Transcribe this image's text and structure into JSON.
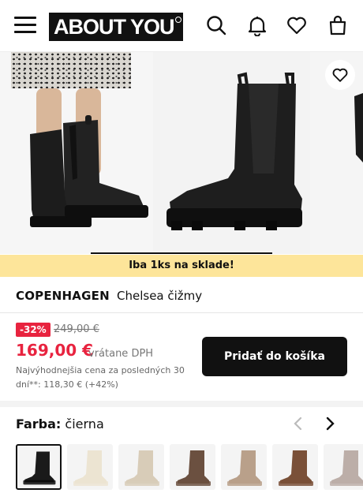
{
  "header": {
    "logo_text": "ABOUT YOU",
    "icons": [
      "menu-icon",
      "search-icon",
      "bell-icon",
      "heart-icon",
      "bag-icon"
    ]
  },
  "gallery": {
    "image_count_visible": 3,
    "colors": {
      "boot": "#1a1a1a",
      "sole": "#111111",
      "background": "#f3f3f3"
    }
  },
  "stock_banner": {
    "text": "Iba 1ks na sklade!",
    "color": "#fde59a"
  },
  "product": {
    "brand": "COPENHAGEN",
    "name": "Chelsea čižmy"
  },
  "price": {
    "discount": "-32%",
    "old_price": "249,00 €",
    "current_price": "169,00 €",
    "vat_note": "vrátane DPH",
    "lowest_price_note": "Najvýhodnejšia cena za posledných 30 dní**: 118,30 € (+42%)",
    "accent_color": "#e8233f"
  },
  "cart": {
    "button_label": "Pridať do košíka"
  },
  "color_selector": {
    "label": "Farba:",
    "selected": "čierna",
    "swatches": [
      {
        "color": "#1a1a1a",
        "selected": true
      },
      {
        "color": "#ece4d2",
        "selected": false
      },
      {
        "color": "#d8ccb8",
        "selected": false
      },
      {
        "color": "#6b5040",
        "selected": false
      },
      {
        "color": "#b9a08a",
        "selected": false
      },
      {
        "color": "#7a5038",
        "selected": false
      },
      {
        "color": "#bcaea8",
        "selected": false
      }
    ]
  }
}
